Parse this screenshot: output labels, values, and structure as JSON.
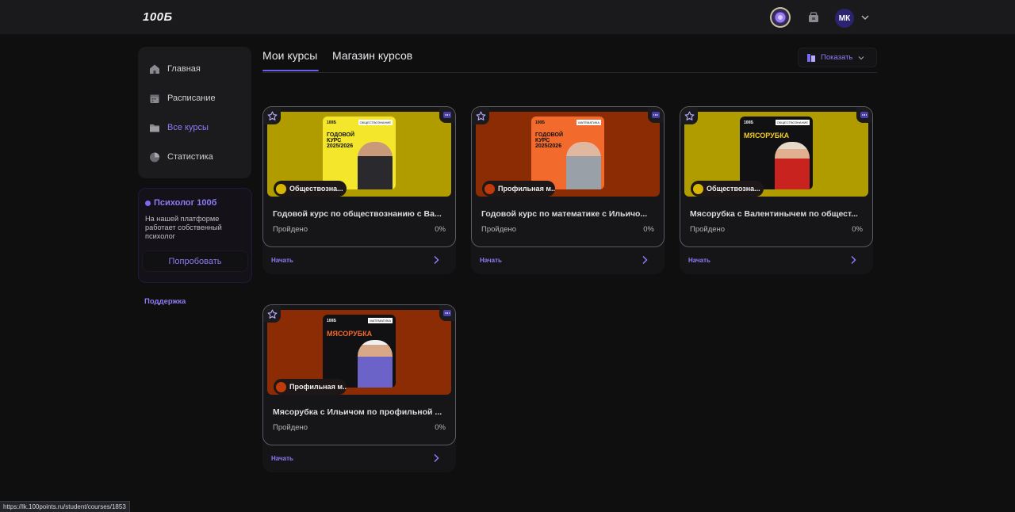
{
  "app": {
    "logo": "100Б"
  },
  "header": {
    "avatar_initials": "МК",
    "icons": [
      "coin-icon",
      "shop-icon",
      "chevron-down-icon"
    ]
  },
  "sidebar": {
    "items": [
      {
        "label": "Главная",
        "icon": "home-icon",
        "active": false
      },
      {
        "label": "Расписание",
        "icon": "calendar-icon",
        "active": false
      },
      {
        "label": "Все курсы",
        "icon": "folder-icon",
        "active": true
      },
      {
        "label": "Статистика",
        "icon": "pie-chart-icon",
        "active": false
      }
    ],
    "psychologist": {
      "title": "Психолог 100б",
      "text": "На нашей платформе работает собственный психолог",
      "button": "Попробовать"
    },
    "support": "Поддержка"
  },
  "tabs": [
    {
      "label": "Мои курсы",
      "active": true
    },
    {
      "label": "Магазин курсов",
      "active": false
    }
  ],
  "show_button": {
    "label": "Показать"
  },
  "courses": [
    {
      "title": "Годовой курс по обществознанию с Ва...",
      "subject": "Обществозна...",
      "status": "Пройдено",
      "progress": "0%",
      "action": "Начать",
      "poster": {
        "brand": "100Б",
        "tag": "ОБЩЕСТВОЗНАНИЕ",
        "title": "ГОДОВОЙ КУРС 2025/2026"
      }
    },
    {
      "title": "Годовой курс по математике с Ильичо...",
      "subject": "Профильная м...",
      "status": "Пройдено",
      "progress": "0%",
      "action": "Начать",
      "poster": {
        "brand": "100Б",
        "tag": "МАТЕМАТИКА",
        "title": "ГОДОВОЙ КУРС 2025/2026"
      }
    },
    {
      "title": "Мясорубка с Валентинычем по общест...",
      "subject": "Обществозна...",
      "status": "Пройдено",
      "progress": "0%",
      "action": "Начать",
      "poster": {
        "brand": "100Б",
        "tag": "ОБЩЕСТВОЗНАНИЕ",
        "title": "МЯСОРУБКА"
      }
    },
    {
      "title": "Мясорубка с Ильичом по профильной ...",
      "subject": "Профильная м...",
      "status": "Пройдено",
      "progress": "0%",
      "action": "Начать",
      "poster": {
        "brand": "100Б",
        "tag": "МАТЕМАТИКА",
        "title": "МЯСОРУБКА"
      }
    }
  ],
  "statusbar": {
    "url": "https://lk.100points.ru/student/courses/1853"
  },
  "colors": {
    "accent": "#8c7cf6",
    "background": "#0f0f10",
    "olive": "#b19c00",
    "rust": "#8b2c04"
  }
}
